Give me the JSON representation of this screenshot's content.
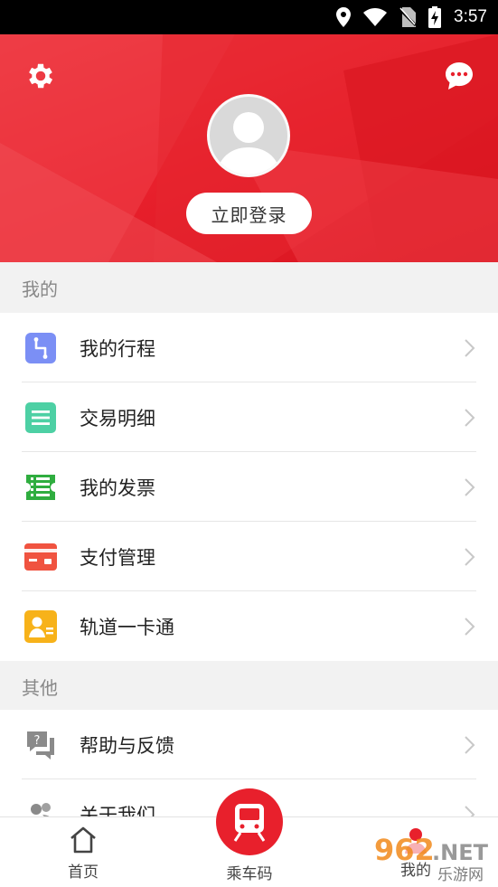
{
  "status_bar": {
    "time": "3:57",
    "icons": [
      "location-icon",
      "wifi-icon",
      "no-sim-icon",
      "battery-charging-icon"
    ]
  },
  "header": {
    "settings_icon": "gear-icon",
    "message_icon": "chat-bubble-icon",
    "login_label": "立即登录",
    "accent_color": "#e8202c"
  },
  "sections": [
    {
      "title": "我的",
      "items": [
        {
          "label": "我的行程",
          "icon": "route-icon",
          "color": "#7b8ff5"
        },
        {
          "label": "交易明细",
          "icon": "list-icon",
          "color": "#4dd0a4"
        },
        {
          "label": "我的发票",
          "icon": "invoice-icon",
          "color": "#2fad3f"
        },
        {
          "label": "支付管理",
          "icon": "card-icon",
          "color": "#f05340"
        },
        {
          "label": "轨道一卡通",
          "icon": "transit-card-icon",
          "color": "#f7b21a"
        }
      ]
    },
    {
      "title": "其他",
      "items": [
        {
          "label": "帮助与反馈",
          "icon": "help-feedback-icon",
          "color": "#888888"
        },
        {
          "label": "关于我们",
          "icon": "about-us-icon",
          "color": "#888888"
        }
      ]
    }
  ],
  "bottom_nav": {
    "home_label": "首页",
    "ride_code_label": "乘车码",
    "mine_label": "我的"
  },
  "watermark": {
    "text": "962.NET",
    "subtext": "乐游网"
  }
}
